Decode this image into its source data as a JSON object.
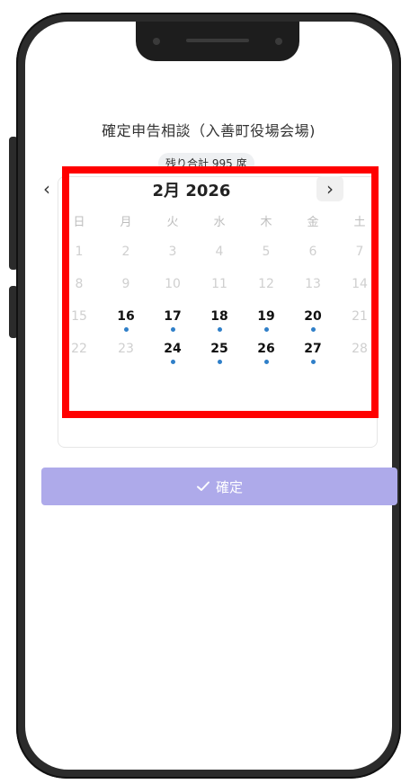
{
  "title": "確定申告相談（入善町役場会場)",
  "seats_badge": "残り合計 995 席",
  "calendar": {
    "month_label": "2月 2026",
    "prev_icon": "‹",
    "next_icon": "›",
    "weekdays": [
      "日",
      "月",
      "火",
      "水",
      "木",
      "金",
      "土"
    ],
    "days": [
      {
        "label": "1",
        "available": false
      },
      {
        "label": "2",
        "available": false
      },
      {
        "label": "3",
        "available": false
      },
      {
        "label": "4",
        "available": false
      },
      {
        "label": "5",
        "available": false
      },
      {
        "label": "6",
        "available": false
      },
      {
        "label": "7",
        "available": false
      },
      {
        "label": "8",
        "available": false
      },
      {
        "label": "9",
        "available": false
      },
      {
        "label": "10",
        "available": false
      },
      {
        "label": "11",
        "available": false
      },
      {
        "label": "12",
        "available": false
      },
      {
        "label": "13",
        "available": false
      },
      {
        "label": "14",
        "available": false
      },
      {
        "label": "15",
        "available": false
      },
      {
        "label": "16",
        "available": true
      },
      {
        "label": "17",
        "available": true
      },
      {
        "label": "18",
        "available": true
      },
      {
        "label": "19",
        "available": true
      },
      {
        "label": "20",
        "available": true
      },
      {
        "label": "21",
        "available": false
      },
      {
        "label": "22",
        "available": false
      },
      {
        "label": "23",
        "available": false
      },
      {
        "label": "24",
        "available": true
      },
      {
        "label": "25",
        "available": true
      },
      {
        "label": "26",
        "available": true
      },
      {
        "label": "27",
        "available": true
      },
      {
        "label": "28",
        "available": false
      }
    ],
    "dot_color": "#2f7fc8"
  },
  "confirm_button": {
    "label": "確定",
    "icon": "check-icon",
    "color": "#aeaaea"
  }
}
